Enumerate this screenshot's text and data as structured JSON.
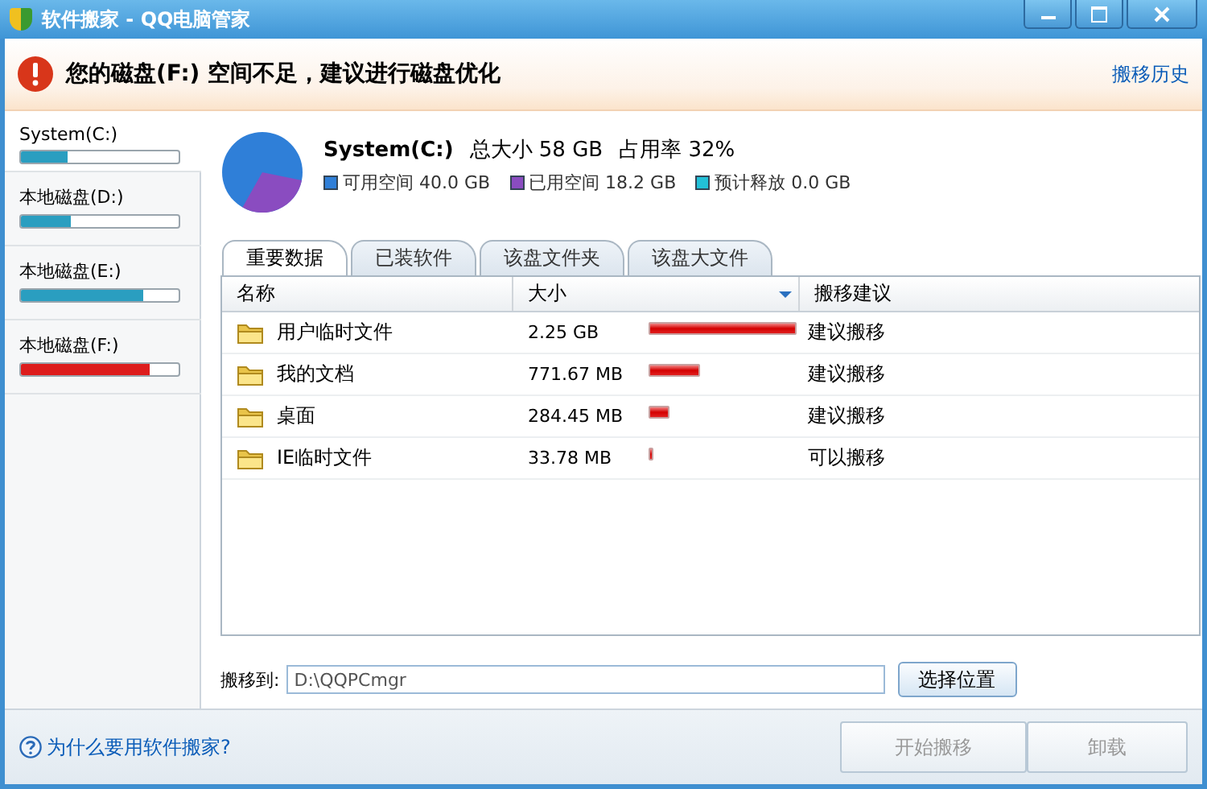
{
  "window": {
    "title": "软件搬家 - QQ电脑管家"
  },
  "alert": {
    "message": "您的磁盘(F:) 空间不足，建议进行磁盘优化",
    "link": "搬移历史"
  },
  "sidebar": {
    "items": [
      {
        "label": "System(C:)",
        "level": 0.3,
        "color": "#2a9ec0",
        "selected": true
      },
      {
        "label": "本地磁盘(D:)",
        "level": 0.32,
        "color": "#2a9ec0",
        "selected": false
      },
      {
        "label": "本地磁盘(E:)",
        "level": 0.78,
        "color": "#2a9ec0",
        "selected": false
      },
      {
        "label": "本地磁盘(F:)",
        "level": 0.82,
        "color": "#dd1c1c",
        "selected": false
      }
    ]
  },
  "disk": {
    "name": "System(C:)",
    "total_label": "总大小",
    "total": "58 GB",
    "usage_label": "占用率",
    "usage": "32%",
    "legend": [
      {
        "label": "可用空间",
        "value": "40.0 GB",
        "color": "#2f7fd8"
      },
      {
        "label": "已用空间",
        "value": "18.2 GB",
        "color": "#8a4cc0"
      },
      {
        "label": "预计释放",
        "value": "0.0 GB",
        "color": "#22c0d8"
      }
    ]
  },
  "tabs": [
    {
      "label": "重要数据",
      "selected": true
    },
    {
      "label": "已装软件",
      "selected": false
    },
    {
      "label": "该盘文件夹",
      "selected": false
    },
    {
      "label": "该盘大文件",
      "selected": false
    }
  ],
  "table": {
    "columns": [
      "名称",
      "大小",
      "搬移建议"
    ],
    "rows": [
      {
        "name": "用户临时文件",
        "size": "2.25 GB",
        "advice": "建议搬移"
      },
      {
        "name": "我的文档",
        "size": "771.67 MB",
        "advice": "建议搬移"
      },
      {
        "name": "桌面",
        "size": "284.45 MB",
        "advice": "建议搬移"
      },
      {
        "name": "IE临时文件",
        "size": "33.78 MB",
        "advice": "可以搬移"
      }
    ]
  },
  "move_to": {
    "label": "搬移到:",
    "value": "D:\\QQPCmgr",
    "button": "选择位置"
  },
  "footer": {
    "help": "为什么要用软件搬家?",
    "buttons": [
      {
        "label": "开始搬移",
        "disabled": true
      },
      {
        "label": "卸载",
        "disabled": true
      }
    ]
  }
}
